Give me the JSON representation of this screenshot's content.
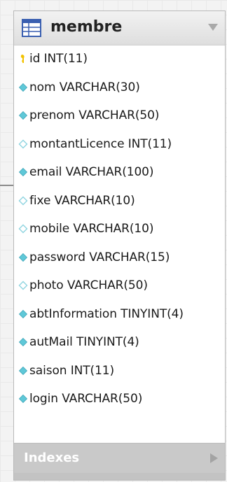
{
  "table": {
    "name": "membre",
    "columns": [
      {
        "text": "id INT(11)",
        "icon": "key-icon"
      },
      {
        "text": "nom VARCHAR(30)",
        "icon": "filled-diamond-icon"
      },
      {
        "text": "prenom VARCHAR(50)",
        "icon": "filled-diamond-icon"
      },
      {
        "text": "montantLicence INT(11)",
        "icon": "hollow-diamond-icon"
      },
      {
        "text": "email VARCHAR(100)",
        "icon": "filled-diamond-icon"
      },
      {
        "text": "fixe VARCHAR(10)",
        "icon": "hollow-diamond-icon"
      },
      {
        "text": "mobile VARCHAR(10)",
        "icon": "hollow-diamond-icon"
      },
      {
        "text": "password VARCHAR(15)",
        "icon": "filled-diamond-icon"
      },
      {
        "text": "photo VARCHAR(50)",
        "icon": "hollow-diamond-icon"
      },
      {
        "text": "abtInformation TINYINT(4)",
        "icon": "filled-diamond-icon"
      },
      {
        "text": "autMail TINYINT(4)",
        "icon": "filled-diamond-icon"
      },
      {
        "text": "saison INT(11)",
        "icon": "filled-diamond-icon"
      },
      {
        "text": "login VARCHAR(50)",
        "icon": "filled-diamond-icon"
      }
    ],
    "indexes_label": "Indexes"
  },
  "colors": {
    "key": "#f2c200",
    "filled_diamond": "#5fc8d8",
    "hollow_diamond": "#8fd4e0"
  }
}
